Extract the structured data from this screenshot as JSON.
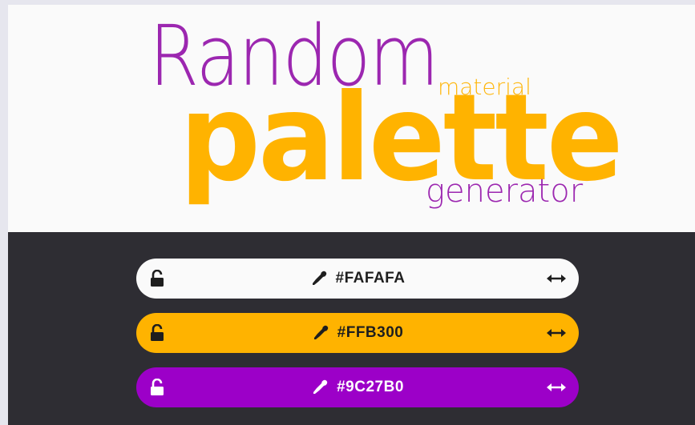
{
  "hero": {
    "word_random": "Random",
    "word_palette": "palette",
    "word_material": "material",
    "word_generator": "generator"
  },
  "colors": {
    "purple": "#9c27b0",
    "amber": "#ffb300",
    "panel_bg": "#2e2d33"
  },
  "palette": [
    {
      "hex": "#FAFAFA",
      "locked": false,
      "icons": [
        "unlock-icon",
        "eyedropper-icon",
        "resize-horizontal-icon"
      ]
    },
    {
      "hex": "#FFB300",
      "locked": false,
      "icons": [
        "unlock-icon",
        "eyedropper-icon",
        "resize-horizontal-icon"
      ]
    },
    {
      "hex": "#9C27B0",
      "locked": false,
      "icons": [
        "unlock-icon",
        "eyedropper-icon",
        "resize-horizontal-icon"
      ]
    }
  ]
}
